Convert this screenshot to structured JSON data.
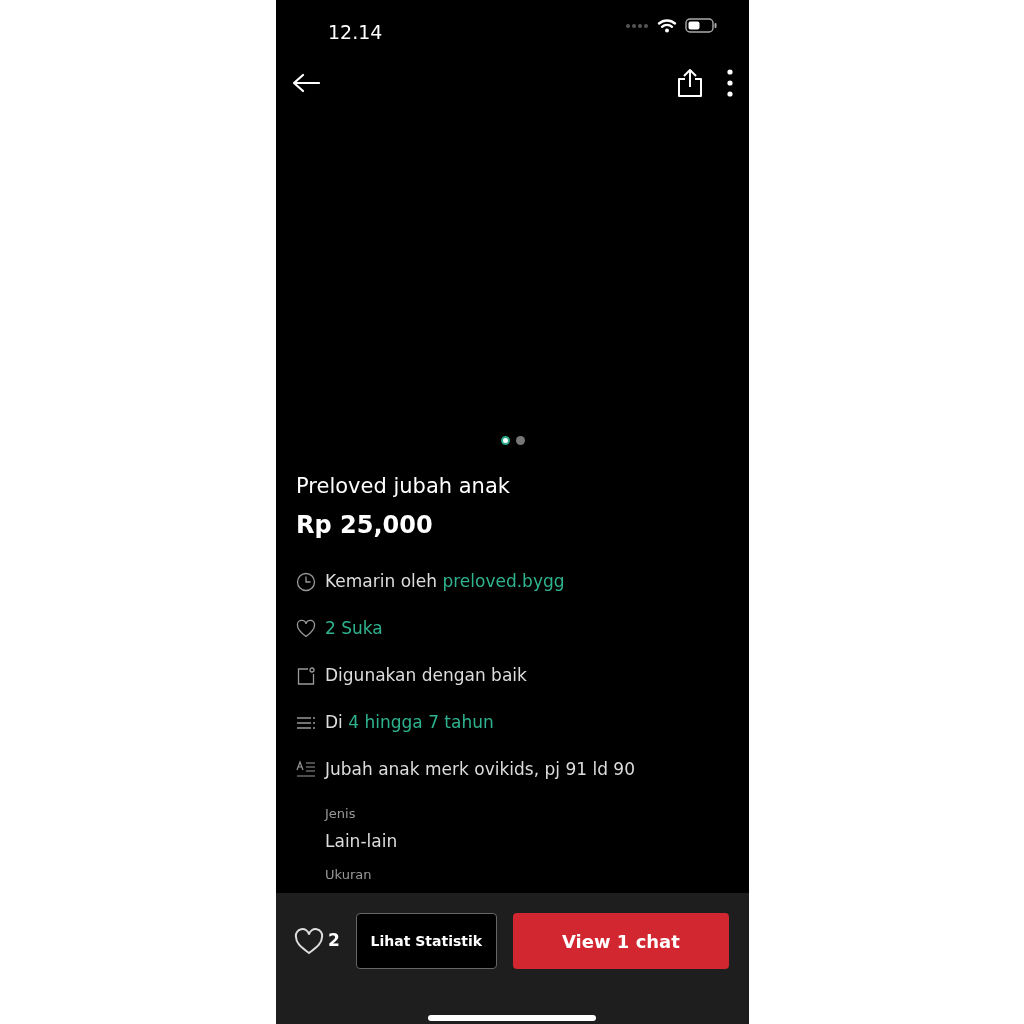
{
  "status_bar": {
    "time": "12.14"
  },
  "carousel": {
    "dots": [
      {
        "selected": true
      },
      {
        "selected": false
      }
    ]
  },
  "listing": {
    "title": "Preloved jubah anak",
    "price": "Rp 25,000"
  },
  "details": [
    {
      "kind": "clock",
      "text": "Kemarin oleh",
      "link": "preloved.bygg"
    },
    {
      "kind": "heart",
      "link": "2 Suka"
    },
    {
      "kind": "tag",
      "text": "Digunakan dengan baik"
    },
    {
      "kind": "list",
      "text": "Di",
      "link": "4 hingga 7 tahun"
    },
    {
      "kind": "description",
      "text": "Jubah anak merk ovikids, pj 91 ld  90"
    }
  ],
  "attributes": [
    {
      "label": "Jenis",
      "value": "Lain-lain"
    },
    {
      "label": "Ukuran"
    }
  ],
  "bottom_bar": {
    "likes": "2",
    "stats_button": "Lihat Statistik",
    "chat_button": "View 1 chat"
  }
}
